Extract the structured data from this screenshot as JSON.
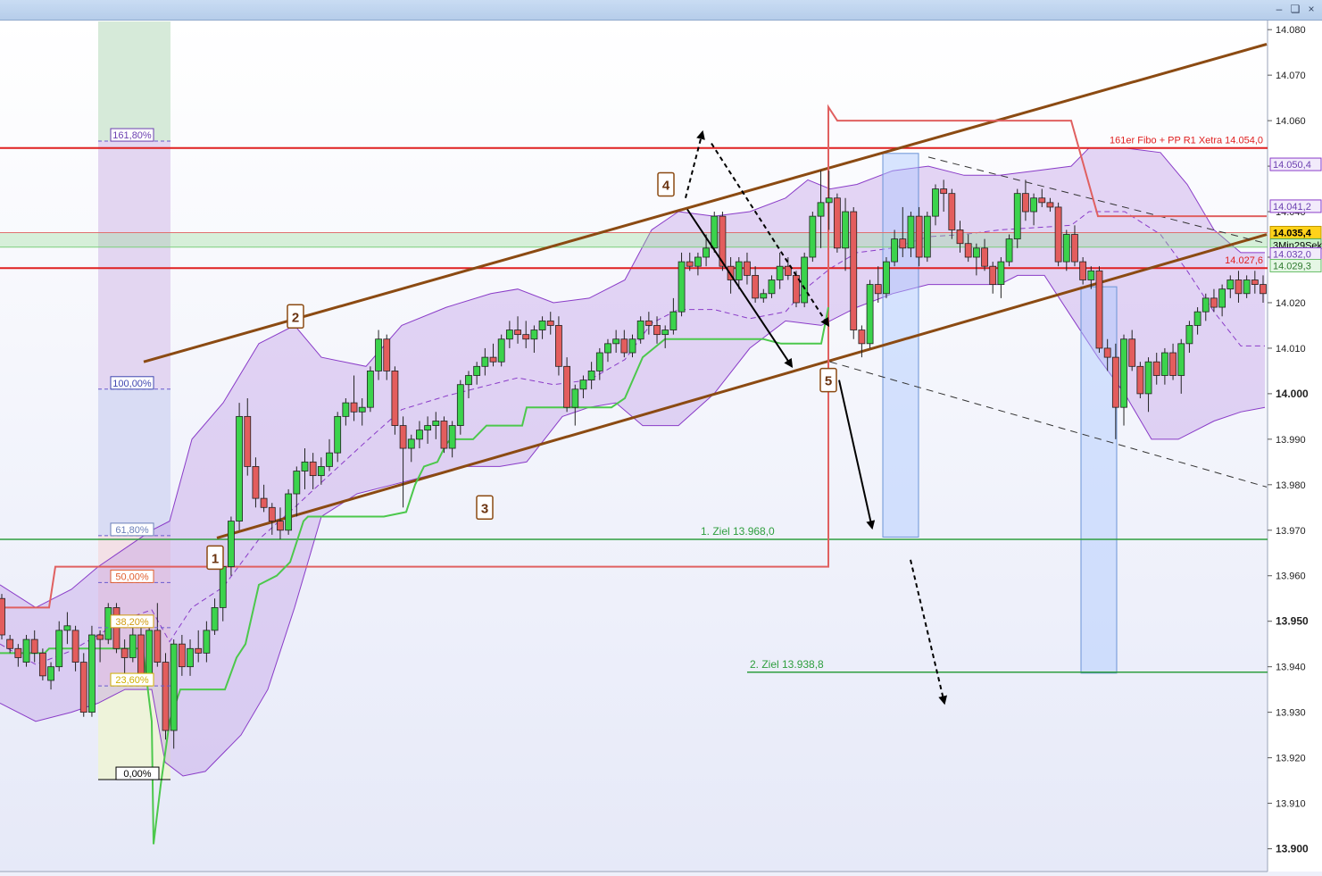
{
  "window": {
    "controls": [
      "minimize-icon",
      "restore-icon",
      "close-icon"
    ]
  },
  "chart_data": {
    "type": "candlestick",
    "y_axis": {
      "min": 13895,
      "max": 14082,
      "ticks": [
        "14.080",
        "14.070",
        "14.060",
        "14.050",
        "14.040",
        "14.030",
        "14.020",
        "14.010",
        "14.000",
        "13.990",
        "13.980",
        "13.970",
        "13.960",
        "13.950",
        "13.940",
        "13.930",
        "13.920",
        "13.910",
        "13.900"
      ],
      "tick_values": [
        14080,
        14070,
        14060,
        14050,
        14040,
        14030,
        14020,
        14010,
        14000,
        13990,
        13980,
        13970,
        13960,
        13950,
        13940,
        13930,
        13920,
        13910,
        13900
      ],
      "bold_ticks": [
        14000,
        13950,
        13900
      ]
    },
    "price_labels": [
      {
        "value": 14050.4,
        "text": "14.050,4",
        "style": "band"
      },
      {
        "value": 14041.2,
        "text": "14.041,2",
        "style": "band"
      },
      {
        "value": 14035.4,
        "text": "14.035,4",
        "style": "current"
      },
      {
        "value": 14033.0,
        "text": "3Min29Sek",
        "style": "timer"
      },
      {
        "value": 14031.2,
        "text": "14.032,0",
        "style": "band"
      },
      {
        "value": 14029.3,
        "text": "14.029,3",
        "style": "green"
      }
    ],
    "levels": [
      {
        "value": 14054.0,
        "label": "161er Fibo + PP R1 Xetra 14.054,0",
        "color": "#e02020"
      },
      {
        "value": 14027.6,
        "label": "14.027,6",
        "color": "#e02020"
      },
      {
        "value": 13968.0,
        "label": "1. Ziel 13.968,0",
        "color": "#2e9e3e"
      },
      {
        "value": 13938.8,
        "label": "2. Ziel 13.938,8",
        "color": "#2e9e3e"
      }
    ],
    "fibonacci": [
      {
        "label": "161,80%",
        "value": 14055.5
      },
      {
        "label": "100,00%",
        "value": 14001.0
      },
      {
        "label": "61,80%",
        "value": 13968.8
      },
      {
        "label": "50,00%",
        "value": 13958.5
      },
      {
        "label": "38,20%",
        "value": 13948.6
      },
      {
        "label": "23,60%",
        "value": 13935.8
      },
      {
        "label": "0,00%",
        "value": 13915.2
      }
    ],
    "wave_labels": [
      "1",
      "2",
      "3",
      "4",
      "5"
    ],
    "candles": [
      {
        "o": 13955,
        "h": 13956,
        "l": 13946,
        "c": 13947
      },
      {
        "o": 13946,
        "h": 13947,
        "l": 13943,
        "c": 13944
      },
      {
        "o": 13944,
        "h": 13945,
        "l": 13940,
        "c": 13942
      },
      {
        "o": 13941,
        "h": 13947,
        "l": 13940,
        "c": 13946
      },
      {
        "o": 13946,
        "h": 13948,
        "l": 13941,
        "c": 13943
      },
      {
        "o": 13943,
        "h": 13944,
        "l": 13937,
        "c": 13938
      },
      {
        "o": 13937,
        "h": 13941,
        "l": 13935,
        "c": 13940
      },
      {
        "o": 13940,
        "h": 13950,
        "l": 13939,
        "c": 13948
      },
      {
        "o": 13948,
        "h": 13952,
        "l": 13945,
        "c": 13949
      },
      {
        "o": 13948,
        "h": 13949,
        "l": 13939,
        "c": 13941
      },
      {
        "o": 13941,
        "h": 13943,
        "l": 13929,
        "c": 13930
      },
      {
        "o": 13930,
        "h": 13949,
        "l": 13929,
        "c": 13947
      },
      {
        "o": 13947,
        "h": 13948,
        "l": 13941,
        "c": 13946
      },
      {
        "o": 13946,
        "h": 13954,
        "l": 13945,
        "c": 13953
      },
      {
        "o": 13953,
        "h": 13954,
        "l": 13943,
        "c": 13944
      },
      {
        "o": 13944,
        "h": 13946,
        "l": 13938,
        "c": 13942
      },
      {
        "o": 13942,
        "h": 13949,
        "l": 13941,
        "c": 13947
      },
      {
        "o": 13947,
        "h": 13950,
        "l": 13936,
        "c": 13938
      },
      {
        "o": 13938,
        "h": 13949,
        "l": 13937,
        "c": 13948
      },
      {
        "o": 13948,
        "h": 13954,
        "l": 13940,
        "c": 13941
      },
      {
        "o": 13941,
        "h": 13943,
        "l": 13924,
        "c": 13926
      },
      {
        "o": 13926,
        "h": 13946,
        "l": 13922,
        "c": 13945
      },
      {
        "o": 13945,
        "h": 13947,
        "l": 13938,
        "c": 13940
      },
      {
        "o": 13940,
        "h": 13946,
        "l": 13938,
        "c": 13944
      },
      {
        "o": 13944,
        "h": 13948,
        "l": 13941,
        "c": 13943
      },
      {
        "o": 13943,
        "h": 13950,
        "l": 13941,
        "c": 13948
      },
      {
        "o": 13948,
        "h": 13955,
        "l": 13947,
        "c": 13953
      },
      {
        "o": 13953,
        "h": 13963,
        "l": 13950,
        "c": 13962
      },
      {
        "o": 13962,
        "h": 13973,
        "l": 13960,
        "c": 13972
      },
      {
        "o": 13972,
        "h": 13998,
        "l": 13970,
        "c": 13995
      },
      {
        "o": 13995,
        "h": 13999,
        "l": 13982,
        "c": 13984
      },
      {
        "o": 13984,
        "h": 13986,
        "l": 13975,
        "c": 13977
      },
      {
        "o": 13977,
        "h": 13980,
        "l": 13974,
        "c": 13975
      },
      {
        "o": 13975,
        "h": 13976,
        "l": 13969,
        "c": 13972
      },
      {
        "o": 13972,
        "h": 13975,
        "l": 13968,
        "c": 13970
      },
      {
        "o": 13970,
        "h": 13979,
        "l": 13969,
        "c": 13978
      },
      {
        "o": 13978,
        "h": 13984,
        "l": 13973,
        "c": 13983
      },
      {
        "o": 13983,
        "h": 13988,
        "l": 13979,
        "c": 13985
      },
      {
        "o": 13985,
        "h": 13987,
        "l": 13979,
        "c": 13982
      },
      {
        "o": 13982,
        "h": 13986,
        "l": 13980,
        "c": 13984
      },
      {
        "o": 13984,
        "h": 13990,
        "l": 13983,
        "c": 13987
      },
      {
        "o": 13987,
        "h": 13996,
        "l": 13985,
        "c": 13995
      },
      {
        "o": 13995,
        "h": 13999,
        "l": 13993,
        "c": 13998
      },
      {
        "o": 13998,
        "h": 14004,
        "l": 13994,
        "c": 13996
      },
      {
        "o": 13996,
        "h": 13999,
        "l": 13993,
        "c": 13997
      },
      {
        "o": 13997,
        "h": 14006,
        "l": 13996,
        "c": 14005
      },
      {
        "o": 14005,
        "h": 14014,
        "l": 14003,
        "c": 14012
      },
      {
        "o": 14012,
        "h": 14013,
        "l": 14003,
        "c": 14005
      },
      {
        "o": 14005,
        "h": 14006,
        "l": 13991,
        "c": 13993
      },
      {
        "o": 13993,
        "h": 13995,
        "l": 13975,
        "c": 13988
      },
      {
        "o": 13988,
        "h": 13991,
        "l": 13985,
        "c": 13990
      },
      {
        "o": 13990,
        "h": 13994,
        "l": 13988,
        "c": 13992
      },
      {
        "o": 13992,
        "h": 13995,
        "l": 13989,
        "c": 13993
      },
      {
        "o": 13993,
        "h": 13996,
        "l": 13990,
        "c": 13994
      },
      {
        "o": 13994,
        "h": 13995,
        "l": 13987,
        "c": 13988
      },
      {
        "o": 13988,
        "h": 13994,
        "l": 13986,
        "c": 13993
      },
      {
        "o": 13993,
        "h": 14003,
        "l": 13991,
        "c": 14002
      },
      {
        "o": 14002,
        "h": 14005,
        "l": 13999,
        "c": 14004
      },
      {
        "o": 14004,
        "h": 14007,
        "l": 14002,
        "c": 14006
      },
      {
        "o": 14006,
        "h": 14010,
        "l": 14004,
        "c": 14008
      },
      {
        "o": 14008,
        "h": 14011,
        "l": 14006,
        "c": 14007
      },
      {
        "o": 14007,
        "h": 14013,
        "l": 14006,
        "c": 14012
      },
      {
        "o": 14012,
        "h": 14016,
        "l": 14010,
        "c": 14014
      },
      {
        "o": 14014,
        "h": 14017,
        "l": 14011,
        "c": 14013
      },
      {
        "o": 14013,
        "h": 14016,
        "l": 14010,
        "c": 14012
      },
      {
        "o": 14012,
        "h": 14015,
        "l": 14009,
        "c": 14014
      },
      {
        "o": 14014,
        "h": 14017,
        "l": 14012,
        "c": 14016
      },
      {
        "o": 14016,
        "h": 14018,
        "l": 14013,
        "c": 14015
      },
      {
        "o": 14015,
        "h": 14017,
        "l": 14004,
        "c": 14006
      },
      {
        "o": 14006,
        "h": 14008,
        "l": 13996,
        "c": 13997
      },
      {
        "o": 13997,
        "h": 14002,
        "l": 13993,
        "c": 14001
      },
      {
        "o": 14001,
        "h": 14004,
        "l": 13999,
        "c": 14003
      },
      {
        "o": 14003,
        "h": 14007,
        "l": 14001,
        "c": 14005
      },
      {
        "o": 14005,
        "h": 14010,
        "l": 14003,
        "c": 14009
      },
      {
        "o": 14009,
        "h": 14012,
        "l": 14007,
        "c": 14011
      },
      {
        "o": 14011,
        "h": 14014,
        "l": 14009,
        "c": 14012
      },
      {
        "o": 14012,
        "h": 14014,
        "l": 14008,
        "c": 14009
      },
      {
        "o": 14009,
        "h": 14013,
        "l": 14008,
        "c": 14012
      },
      {
        "o": 14012,
        "h": 14017,
        "l": 14011,
        "c": 14016
      },
      {
        "o": 14016,
        "h": 14018,
        "l": 14013,
        "c": 14015
      },
      {
        "o": 14015,
        "h": 14017,
        "l": 14011,
        "c": 14013
      },
      {
        "o": 14013,
        "h": 14015,
        "l": 14010,
        "c": 14014
      },
      {
        "o": 14014,
        "h": 14021,
        "l": 14013,
        "c": 14018
      },
      {
        "o": 14018,
        "h": 14031,
        "l": 14017,
        "c": 14029
      },
      {
        "o": 14029,
        "h": 14031,
        "l": 14027,
        "c": 14028
      },
      {
        "o": 14028,
        "h": 14031,
        "l": 14026,
        "c": 14030
      },
      {
        "o": 14030,
        "h": 14035,
        "l": 14028,
        "c": 14032
      },
      {
        "o": 14032,
        "h": 14040,
        "l": 14031,
        "c": 14039
      },
      {
        "o": 14039,
        "h": 14040,
        "l": 14027,
        "c": 14028
      },
      {
        "o": 14028,
        "h": 14030,
        "l": 14022,
        "c": 14025
      },
      {
        "o": 14025,
        "h": 14030,
        "l": 14023,
        "c": 14029
      },
      {
        "o": 14029,
        "h": 14031,
        "l": 14024,
        "c": 14026
      },
      {
        "o": 14026,
        "h": 14028,
        "l": 14020,
        "c": 14021
      },
      {
        "o": 14021,
        "h": 14023,
        "l": 14020,
        "c": 14022
      },
      {
        "o": 14022,
        "h": 14026,
        "l": 14021,
        "c": 14025
      },
      {
        "o": 14025,
        "h": 14031,
        "l": 14023,
        "c": 14028
      },
      {
        "o": 14028,
        "h": 14030,
        "l": 14025,
        "c": 14026
      },
      {
        "o": 14026,
        "h": 14027,
        "l": 14019,
        "c": 14020
      },
      {
        "o": 14020,
        "h": 14031,
        "l": 14019,
        "c": 14030
      },
      {
        "o": 14030,
        "h": 14040,
        "l": 14029,
        "c": 14039
      },
      {
        "o": 14039,
        "h": 14049,
        "l": 14032,
        "c": 14042
      },
      {
        "o": 14042,
        "h": 14049,
        "l": 14036,
        "c": 14043
      },
      {
        "o": 14043,
        "h": 14044,
        "l": 14031,
        "c": 14032
      },
      {
        "o": 14032,
        "h": 14043,
        "l": 14027,
        "c": 14040
      },
      {
        "o": 14040,
        "h": 14041,
        "l": 14012,
        "c": 14014
      },
      {
        "o": 14014,
        "h": 14015,
        "l": 14008,
        "c": 14011
      },
      {
        "o": 14011,
        "h": 14025,
        "l": 14010,
        "c": 14024
      },
      {
        "o": 14024,
        "h": 14028,
        "l": 14020,
        "c": 14022
      },
      {
        "o": 14022,
        "h": 14030,
        "l": 14021,
        "c": 14029
      },
      {
        "o": 14029,
        "h": 14036,
        "l": 14028,
        "c": 14034
      },
      {
        "o": 14034,
        "h": 14041,
        "l": 14030,
        "c": 14032
      },
      {
        "o": 14032,
        "h": 14040,
        "l": 14030,
        "c": 14039
      },
      {
        "o": 14039,
        "h": 14041,
        "l": 14028,
        "c": 14030
      },
      {
        "o": 14030,
        "h": 14040,
        "l": 14029,
        "c": 14039
      },
      {
        "o": 14039,
        "h": 14046,
        "l": 14037,
        "c": 14045
      },
      {
        "o": 14045,
        "h": 14047,
        "l": 14040,
        "c": 14044
      },
      {
        "o": 14044,
        "h": 14045,
        "l": 14034,
        "c": 14036
      },
      {
        "o": 14036,
        "h": 14038,
        "l": 14031,
        "c": 14033
      },
      {
        "o": 14033,
        "h": 14035,
        "l": 14029,
        "c": 14030
      },
      {
        "o": 14030,
        "h": 14033,
        "l": 14026,
        "c": 14032
      },
      {
        "o": 14032,
        "h": 14034,
        "l": 14027,
        "c": 14028
      },
      {
        "o": 14028,
        "h": 14029,
        "l": 14022,
        "c": 14024
      },
      {
        "o": 14024,
        "h": 14030,
        "l": 14021,
        "c": 14029
      },
      {
        "o": 14029,
        "h": 14035,
        "l": 14028,
        "c": 14034
      },
      {
        "o": 14034,
        "h": 14045,
        "l": 14032,
        "c": 14044
      },
      {
        "o": 14044,
        "h": 14047,
        "l": 14038,
        "c": 14040
      },
      {
        "o": 14040,
        "h": 14044,
        "l": 14037,
        "c": 14043
      },
      {
        "o": 14043,
        "h": 14045,
        "l": 14041,
        "c": 14042
      },
      {
        "o": 14042,
        "h": 14043,
        "l": 14040,
        "c": 14041
      },
      {
        "o": 14041,
        "h": 14042,
        "l": 14028,
        "c": 14029
      },
      {
        "o": 14029,
        "h": 14036,
        "l": 14027,
        "c": 14035
      },
      {
        "o": 14035,
        "h": 14037,
        "l": 14028,
        "c": 14029
      },
      {
        "o": 14029,
        "h": 14030,
        "l": 14024,
        "c": 14025
      },
      {
        "o": 14025,
        "h": 14028,
        "l": 14023,
        "c": 14027
      },
      {
        "o": 14027,
        "h": 14028,
        "l": 14009,
        "c": 14010
      },
      {
        "o": 14010,
        "h": 14012,
        "l": 14005,
        "c": 14008
      },
      {
        "o": 14008,
        "h": 14011,
        "l": 13990,
        "c": 13997
      },
      {
        "o": 13997,
        "h": 14013,
        "l": 13993,
        "c": 14012
      },
      {
        "o": 14012,
        "h": 14014,
        "l": 14005,
        "c": 14006
      },
      {
        "o": 14006,
        "h": 14007,
        "l": 13999,
        "c": 14000
      },
      {
        "o": 14000,
        "h": 14008,
        "l": 13996,
        "c": 14007
      },
      {
        "o": 14007,
        "h": 14009,
        "l": 14002,
        "c": 14004
      },
      {
        "o": 14004,
        "h": 14010,
        "l": 14002,
        "c": 14009
      },
      {
        "o": 14009,
        "h": 14011,
        "l": 14003,
        "c": 14004
      },
      {
        "o": 14004,
        "h": 14012,
        "l": 14000,
        "c": 14011
      },
      {
        "o": 14011,
        "h": 14016,
        "l": 14009,
        "c": 14015
      },
      {
        "o": 14015,
        "h": 14019,
        "l": 14013,
        "c": 14018
      },
      {
        "o": 14018,
        "h": 14022,
        "l": 14016,
        "c": 14021
      },
      {
        "o": 14021,
        "h": 14023,
        "l": 14018,
        "c": 14019
      },
      {
        "o": 14019,
        "h": 14024,
        "l": 14017,
        "c": 14023
      },
      {
        "o": 14023,
        "h": 14026,
        "l": 14021,
        "c": 14025
      },
      {
        "o": 14025,
        "h": 14027,
        "l": 14020,
        "c": 14022
      },
      {
        "o": 14022,
        "h": 14026,
        "l": 14021,
        "c": 14025
      },
      {
        "o": 14025,
        "h": 14027,
        "l": 14022,
        "c": 14024
      },
      {
        "o": 14024,
        "h": 14026,
        "l": 14020,
        "c": 14022
      }
    ]
  }
}
